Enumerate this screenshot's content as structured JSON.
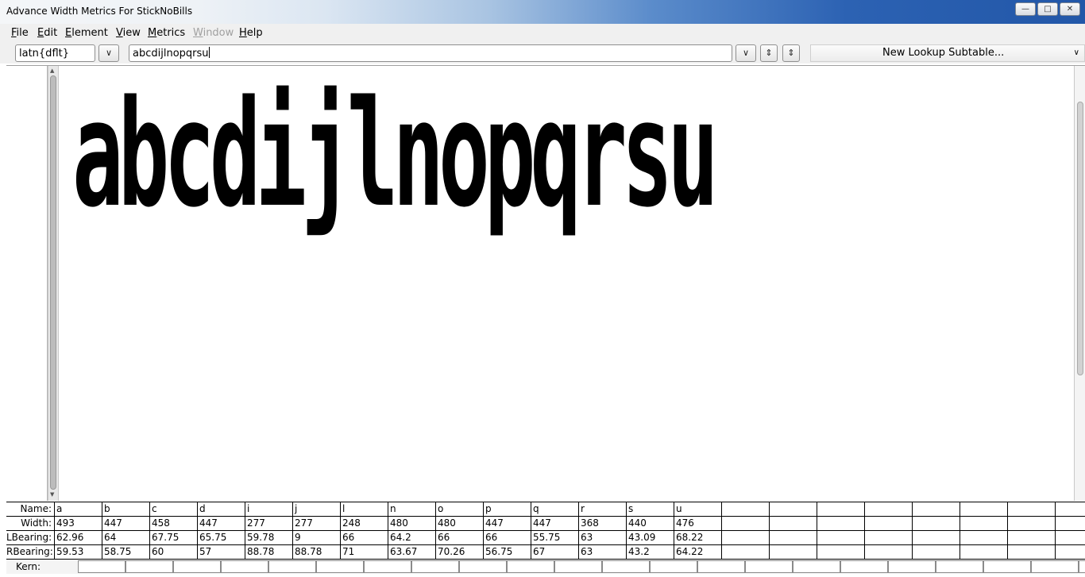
{
  "window": {
    "title": "Advance Width Metrics For StickNoBills",
    "buttons": [
      "minimize",
      "maximize",
      "close"
    ]
  },
  "menu": [
    {
      "label": "File",
      "u": "F",
      "rest": "ile",
      "enabled": true
    },
    {
      "label": "Edit",
      "u": "E",
      "rest": "dit",
      "enabled": true
    },
    {
      "label": "Element",
      "u": "E",
      "rest": "lement",
      "enabled": true
    },
    {
      "label": "View",
      "u": "V",
      "rest": "iew",
      "enabled": true
    },
    {
      "label": "Metrics",
      "u": "M",
      "rest": "etrics",
      "enabled": true
    },
    {
      "label": "Window",
      "u": "W",
      "rest": "indow",
      "enabled": false
    },
    {
      "label": "Help",
      "u": "H",
      "rest": "elp",
      "enabled": true
    }
  ],
  "toolbar": {
    "script_value": "latn{dflt}",
    "text_value": "abcdijlnopqrsu",
    "lookup_label": "New Lookup Subtable..."
  },
  "preview": {
    "glyph_text": "abcdijlnopqrsu"
  },
  "metrics": {
    "row_labels": {
      "name": "Name:",
      "width": "Width:",
      "lbearing": "LBearing:",
      "rbearing": "RBearing:",
      "kern": "Kern:"
    },
    "glyphs": [
      {
        "name": "a",
        "width": "493",
        "lbearing": "62.96",
        "rbearing": "59.53"
      },
      {
        "name": "b",
        "width": "447",
        "lbearing": "64",
        "rbearing": "58.75"
      },
      {
        "name": "c",
        "width": "458",
        "lbearing": "67.75",
        "rbearing": "60"
      },
      {
        "name": "d",
        "width": "447",
        "lbearing": "65.75",
        "rbearing": "57"
      },
      {
        "name": "i",
        "width": "277",
        "lbearing": "59.78",
        "rbearing": "88.78"
      },
      {
        "name": "j",
        "width": "277",
        "lbearing": "9",
        "rbearing": "88.78"
      },
      {
        "name": "l",
        "width": "248",
        "lbearing": "66",
        "rbearing": "71"
      },
      {
        "name": "n",
        "width": "480",
        "lbearing": "64.2",
        "rbearing": "63.67"
      },
      {
        "name": "o",
        "width": "480",
        "lbearing": "66",
        "rbearing": "70.26"
      },
      {
        "name": "p",
        "width": "447",
        "lbearing": "66",
        "rbearing": "56.75"
      },
      {
        "name": "q",
        "width": "447",
        "lbearing": "55.75",
        "rbearing": "67"
      },
      {
        "name": "r",
        "width": "368",
        "lbearing": "63",
        "rbearing": "63"
      },
      {
        "name": "s",
        "width": "440",
        "lbearing": "43.09",
        "rbearing": "43.2"
      },
      {
        "name": "u",
        "width": "476",
        "lbearing": "68.22",
        "rbearing": "64.22"
      }
    ]
  }
}
